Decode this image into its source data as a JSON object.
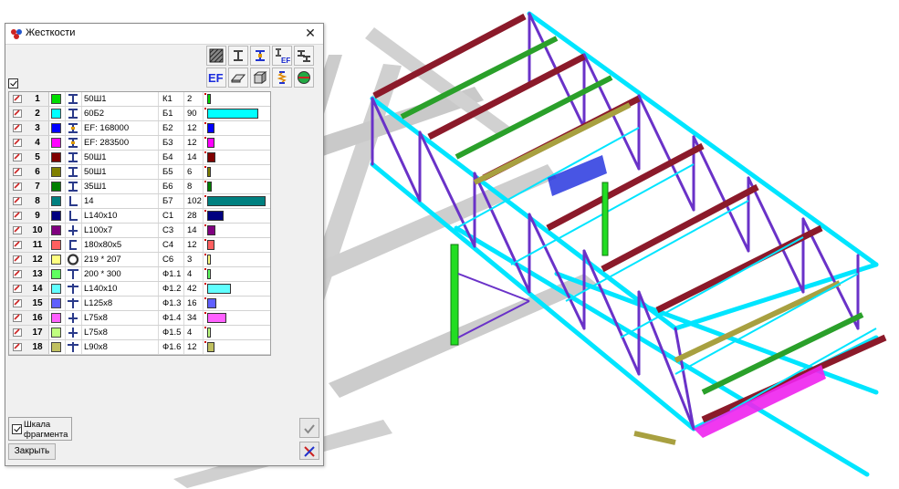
{
  "dialog": {
    "title": "Жесткости",
    "close_label": "✕",
    "toolbar_row1": [
      "hatch-section-icon",
      "i-beam-icon",
      "i-beam-highlight-icon",
      "ef-small-icon",
      "multi-section-icon"
    ],
    "toolbar_row2": [
      "ef-icon",
      "plate-icon",
      "solid-box-icon",
      "spring-icon",
      "globe-icon"
    ],
    "ef_text": "EF",
    "ef_small_text": "EF",
    "bottom": {
      "scale_label_line1": "Шкала",
      "scale_label_line2": "фрагмента",
      "close_button": "Закрыть"
    },
    "rows": [
      {
        "num": "1",
        "color": "#00dd00",
        "type": "i-beam",
        "name": "50Ш1",
        "code": "К1",
        "count": "2",
        "level": 2
      },
      {
        "num": "2",
        "color": "#00ffff",
        "type": "i-beam",
        "name": "60Б2",
        "code": "Б1",
        "count": "90",
        "level": 90
      },
      {
        "num": "3",
        "color": "#0000ff",
        "type": "ef",
        "name": "EF: 168000",
        "code": "Б2",
        "count": "12",
        "level": 12
      },
      {
        "num": "4",
        "color": "#ff00ff",
        "type": "ef",
        "name": "EF: 283500",
        "code": "Б3",
        "count": "12",
        "level": 12
      },
      {
        "num": "5",
        "color": "#800000",
        "type": "i-beam",
        "name": "50Ш1",
        "code": "Б4",
        "count": "14",
        "level": 14
      },
      {
        "num": "6",
        "color": "#808000",
        "type": "i-beam",
        "name": "50Ш1",
        "code": "Б5",
        "count": "6",
        "level": 6
      },
      {
        "num": "7",
        "color": "#008000",
        "type": "i-beam",
        "name": "35Ш1",
        "code": "Б6",
        "count": "8",
        "level": 8
      },
      {
        "num": "8",
        "color": "#008080",
        "type": "angle",
        "name": "14",
        "code": "Б7",
        "count": "102",
        "level": 102
      },
      {
        "num": "9",
        "color": "#000080",
        "type": "angle",
        "name": "L140x10",
        "code": "С1",
        "count": "28",
        "level": 28
      },
      {
        "num": "10",
        "color": "#800080",
        "type": "zangle",
        "name": "L100x7",
        "code": "С3",
        "count": "14",
        "level": 14
      },
      {
        "num": "11",
        "color": "#ff6060",
        "type": "channel",
        "name": "180x80x5",
        "code": "С4",
        "count": "12",
        "level": 12
      },
      {
        "num": "12",
        "color": "#ffff80",
        "type": "pipe",
        "name": "219 * 207",
        "code": "С6",
        "count": "3",
        "level": 3
      },
      {
        "num": "13",
        "color": "#60ff60",
        "type": "tbeam",
        "name": "200 * 300",
        "code": "Ф1.1",
        "count": "4",
        "level": 4
      },
      {
        "num": "14",
        "color": "#60ffff",
        "type": "dblangle",
        "name": "L140x10",
        "code": "Ф1.2",
        "count": "42",
        "level": 42
      },
      {
        "num": "15",
        "color": "#6060ff",
        "type": "dblangle",
        "name": "L125x8",
        "code": "Ф1.3",
        "count": "16",
        "level": 16
      },
      {
        "num": "16",
        "color": "#ff60ff",
        "type": "zangle",
        "name": "L75x8",
        "code": "Ф1.4",
        "count": "34",
        "level": 34
      },
      {
        "num": "17",
        "color": "#c0ff80",
        "type": "zangle",
        "name": "L75x8",
        "code": "Ф1.5",
        "count": "4",
        "level": 4
      },
      {
        "num": "18",
        "color": "#c0c060",
        "type": "dblangle",
        "name": "L90x8",
        "code": "Ф1.6",
        "count": "12",
        "level": 12
      }
    ]
  },
  "colors": {
    "cyan_member": "#00e5ff",
    "purple_member": "#6a32c8",
    "maroon_member": "#8b1a2a",
    "green_member": "#2aa02a",
    "olive_member": "#a8a040",
    "bright_green": "#22dd22",
    "magenta": "#ee22ee",
    "watermark": "#b8b8b8"
  }
}
